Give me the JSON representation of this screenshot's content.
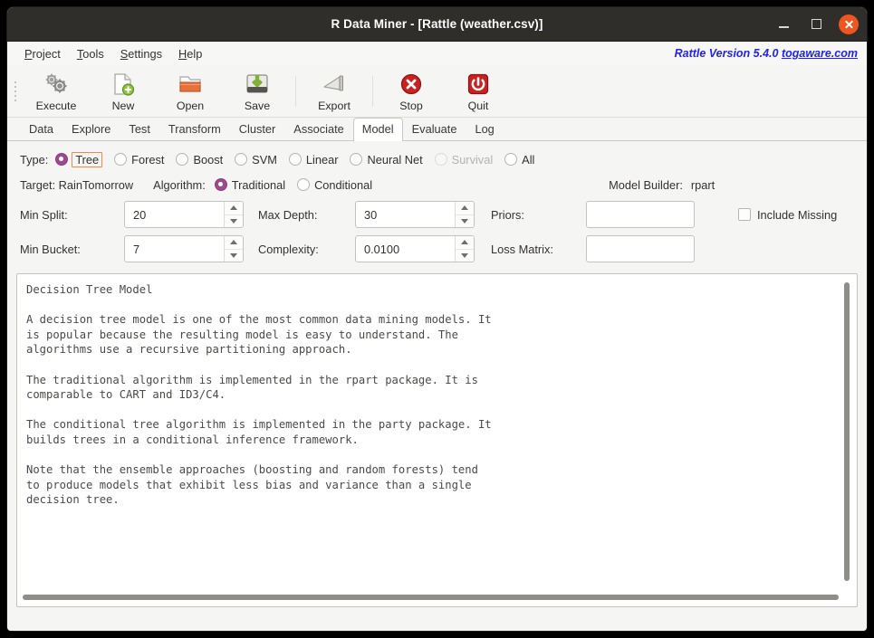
{
  "window": {
    "title": "R Data Miner - [Rattle (weather.csv)]",
    "minimize_label": "Minimize",
    "maximize_label": "Maximize",
    "close_label": "Close",
    "accent_close": "#ed5521",
    "titlebar_bg": "#2f2e2b"
  },
  "menubar": {
    "items": [
      {
        "label": "Project",
        "mnemonic": "P",
        "rest": "roject"
      },
      {
        "label": "Tools",
        "mnemonic": "T",
        "rest": "ools"
      },
      {
        "label": "Settings",
        "mnemonic": "S",
        "rest": "ettings"
      },
      {
        "label": "Help",
        "mnemonic": "H",
        "rest": "elp"
      }
    ],
    "version_text": "Rattle Version 5.4.0 ",
    "version_url": "togaware.com",
    "version_color": "#2222ee"
  },
  "toolbar": {
    "items": [
      {
        "label": "Execute",
        "icon": "gears-icon"
      },
      {
        "label": "New",
        "icon": "new-document-icon"
      },
      {
        "label": "Open",
        "icon": "open-folder-icon"
      },
      {
        "label": "Save",
        "icon": "save-disk-icon"
      },
      {
        "label": "Export",
        "icon": "export-icon"
      },
      {
        "label": "Stop",
        "icon": "stop-icon"
      },
      {
        "label": "Quit",
        "icon": "power-quit-icon"
      }
    ]
  },
  "tabs": {
    "items": [
      {
        "label": "Data",
        "active": false
      },
      {
        "label": "Explore",
        "active": false
      },
      {
        "label": "Test",
        "active": false
      },
      {
        "label": "Transform",
        "active": false
      },
      {
        "label": "Cluster",
        "active": false
      },
      {
        "label": "Associate",
        "active": false
      },
      {
        "label": "Model",
        "active": true
      },
      {
        "label": "Evaluate",
        "active": false
      },
      {
        "label": "Log",
        "active": false
      }
    ]
  },
  "options": {
    "type_label": "Type:",
    "type_options": [
      {
        "label": "Tree",
        "checked": true,
        "disabled": false,
        "focused": true
      },
      {
        "label": "Forest",
        "checked": false,
        "disabled": false,
        "focused": false
      },
      {
        "label": "Boost",
        "checked": false,
        "disabled": false,
        "focused": false
      },
      {
        "label": "SVM",
        "checked": false,
        "disabled": false,
        "focused": false
      },
      {
        "label": "Linear",
        "checked": false,
        "disabled": false,
        "focused": false
      },
      {
        "label": "Neural Net",
        "checked": false,
        "disabled": false,
        "focused": false
      },
      {
        "label": "Survival",
        "checked": false,
        "disabled": true,
        "focused": false
      },
      {
        "label": "All",
        "checked": false,
        "disabled": false,
        "focused": false
      }
    ],
    "target_label": "Target: RainTomorrow",
    "algorithm_label": "Algorithm:",
    "algorithm_options": [
      {
        "label": "Traditional",
        "checked": true
      },
      {
        "label": "Conditional",
        "checked": false
      }
    ],
    "model_builder_label": "Model Builder:",
    "model_builder_value": "rpart",
    "min_split_label": "Min Split:",
    "min_split_value": "20",
    "max_depth_label": "Max Depth:",
    "max_depth_value": "30",
    "priors_label": "Priors:",
    "priors_value": "",
    "include_missing_label": "Include Missing",
    "include_missing_checked": false,
    "min_bucket_label": "Min Bucket:",
    "min_bucket_value": "7",
    "complexity_label": "Complexity:",
    "complexity_value": "0.0100",
    "loss_matrix_label": "Loss Matrix:",
    "loss_matrix_value": "",
    "radio_accent": "#9b4a8d",
    "focus_accent": "#ed8a4e"
  },
  "textview": {
    "content": "Decision Tree Model\n\nA decision tree model is one of the most common data mining models. It\nis popular because the resulting model is easy to understand. The\nalgorithms use a recursive partitioning approach.\n\nThe traditional algorithm is implemented in the rpart package. It is\ncomparable to CART and ID3/C4.\n\nThe conditional tree algorithm is implemented in the party package. It\nbuilds trees in a conditional inference framework.\n\nNote that the ensemble approaches (boosting and random forests) tend\nto produce models that exhibit less bias and variance than a single\ndecision tree."
  }
}
